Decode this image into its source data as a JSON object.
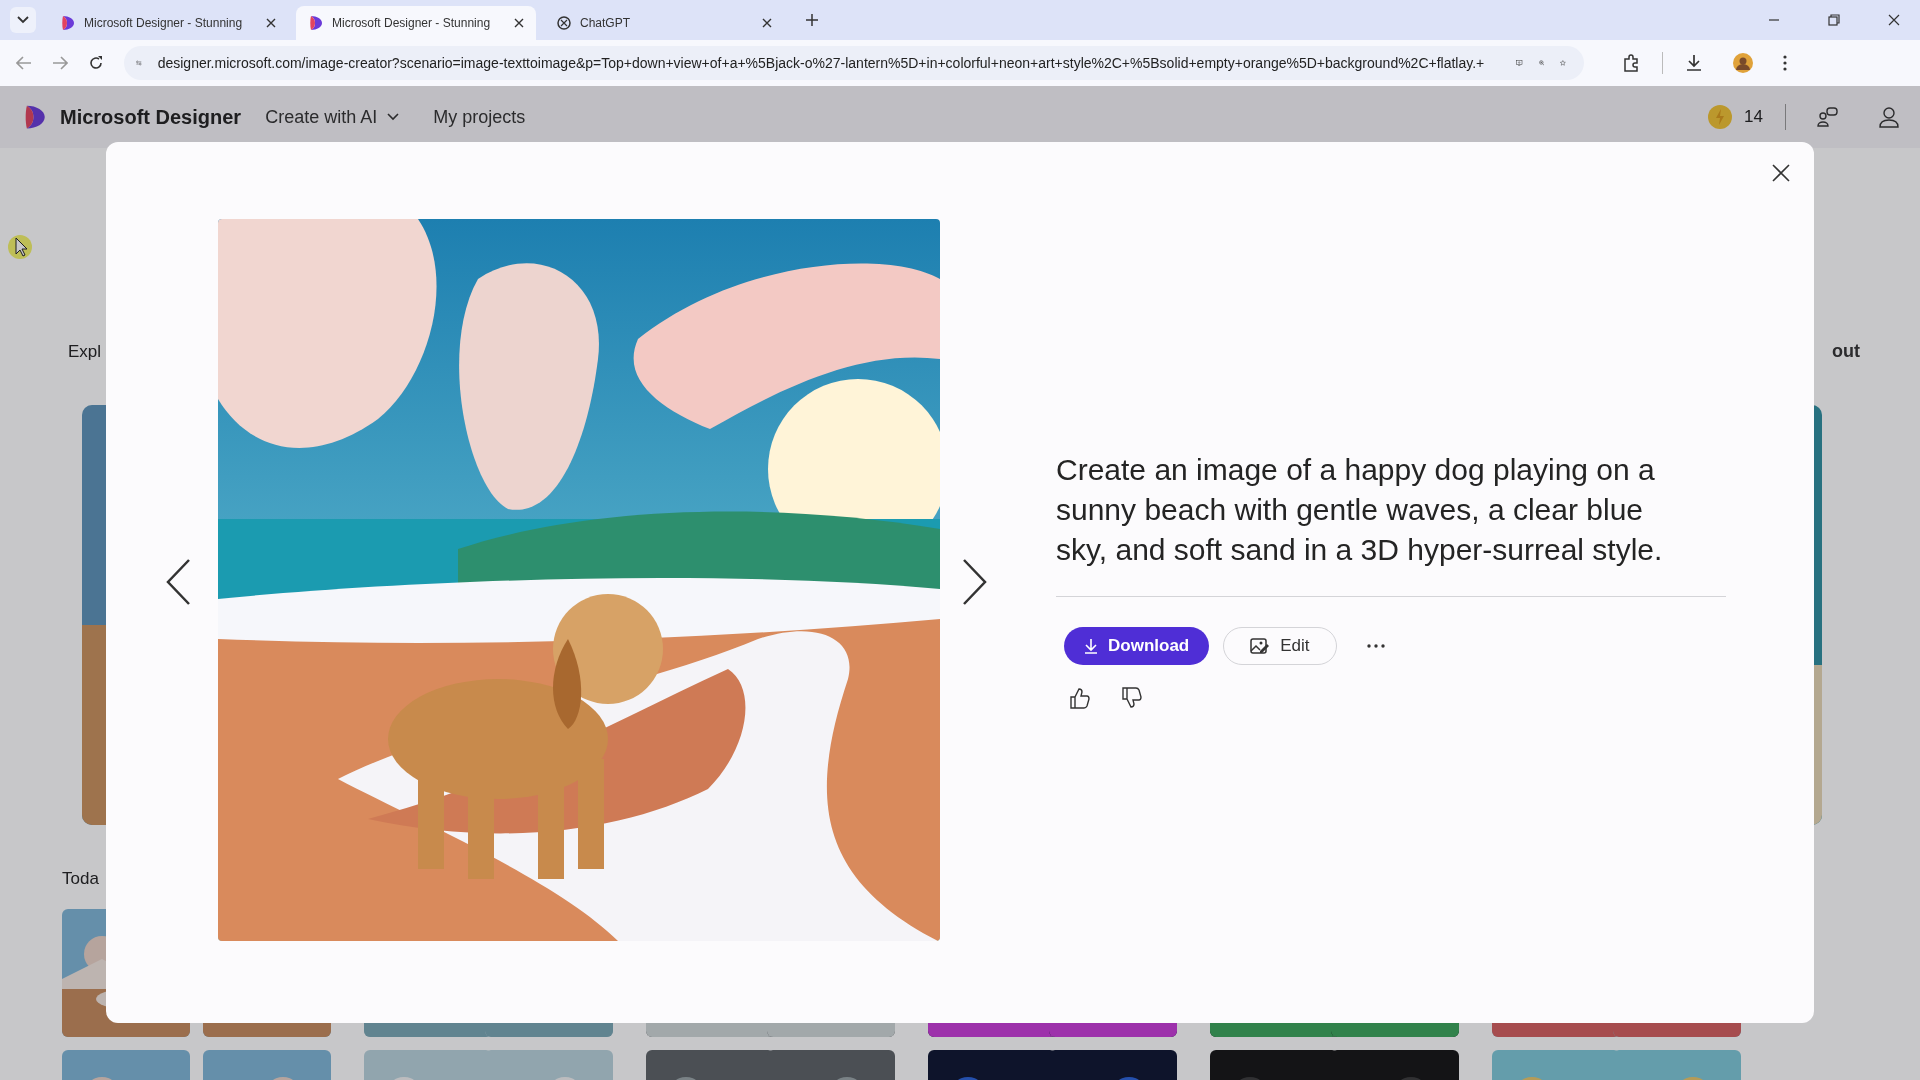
{
  "browser": {
    "tabs": [
      {
        "title": "Microsoft Designer - Stunning",
        "kind": "designer",
        "selected": false
      },
      {
        "title": "Microsoft Designer - Stunning",
        "kind": "designer",
        "selected": true
      },
      {
        "title": "ChatGPT",
        "kind": "chatgpt",
        "selected": false
      }
    ],
    "url": "designer.microsoft.com/image-creator?scenario=image-texttoimage&p=Top+down+view+of+a+%5Bjack-o%27-lantern%5D+in+colorful+neon+art+style%2C+%5Bsolid+empty+orange%5D+background%2C+flatlay.+"
  },
  "app_header": {
    "brand": "Microsoft Designer",
    "nav": [
      {
        "label": "Create with AI",
        "kind": "dropdown"
      },
      {
        "label": "My projects",
        "kind": "link"
      }
    ],
    "credits": "14"
  },
  "background": {
    "section_heading": "Expl",
    "side_link": "out",
    "section_heading_2": "Toda"
  },
  "modal": {
    "prompt": "Create an image of a happy dog playing on a sunny beach with gentle waves, a clear blue sky, and soft sand in a 3D hyper-surreal style.",
    "actions": [
      {
        "label": "Download",
        "kind": "primary"
      },
      {
        "label": "Edit",
        "kind": "secondary"
      }
    ]
  }
}
